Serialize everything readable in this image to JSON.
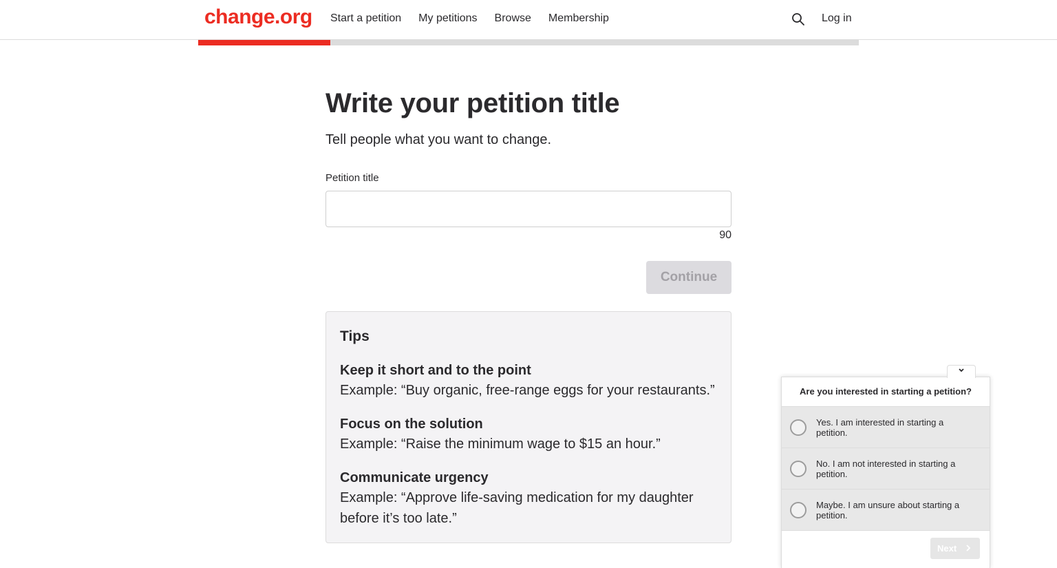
{
  "header": {
    "logo": "change.org",
    "nav": [
      {
        "label": "Start a petition"
      },
      {
        "label": "My petitions"
      },
      {
        "label": "Browse"
      },
      {
        "label": "Membership"
      }
    ],
    "login": "Log in"
  },
  "progress": {
    "fraction": 0.2
  },
  "main": {
    "title": "Write your petition title",
    "subtitle": "Tell people what you want to change.",
    "field_label": "Petition title",
    "input_value": "",
    "char_count": "90",
    "continue_label": "Continue"
  },
  "tips": {
    "heading": "Tips",
    "items": [
      {
        "title": "Keep it short and to the point",
        "example": "Example: “Buy organic, free-range eggs for your restaurants.”"
      },
      {
        "title": "Focus on the solution",
        "example": "Example: “Raise the minimum wage to $15 an hour.”"
      },
      {
        "title": "Communicate urgency",
        "example": "Example: “Approve life-saving medication for my daughter before it’s too late.”"
      }
    ]
  },
  "survey": {
    "question": "Are you interested in starting a petition?",
    "options": [
      {
        "label": "Yes. I am interested in starting a petition."
      },
      {
        "label": "No. I am not interested in starting a petition."
      },
      {
        "label": "Maybe. I am unsure about starting a petition."
      }
    ],
    "next_label": "Next"
  },
  "colors": {
    "brand": "#ec2c22",
    "progress_track": "#dcdcdc",
    "disabled_button": "#dcdbdf"
  },
  "icons": {
    "search": "search-icon",
    "collapse": "chevron-down-icon",
    "next": "chevron-right-icon"
  }
}
